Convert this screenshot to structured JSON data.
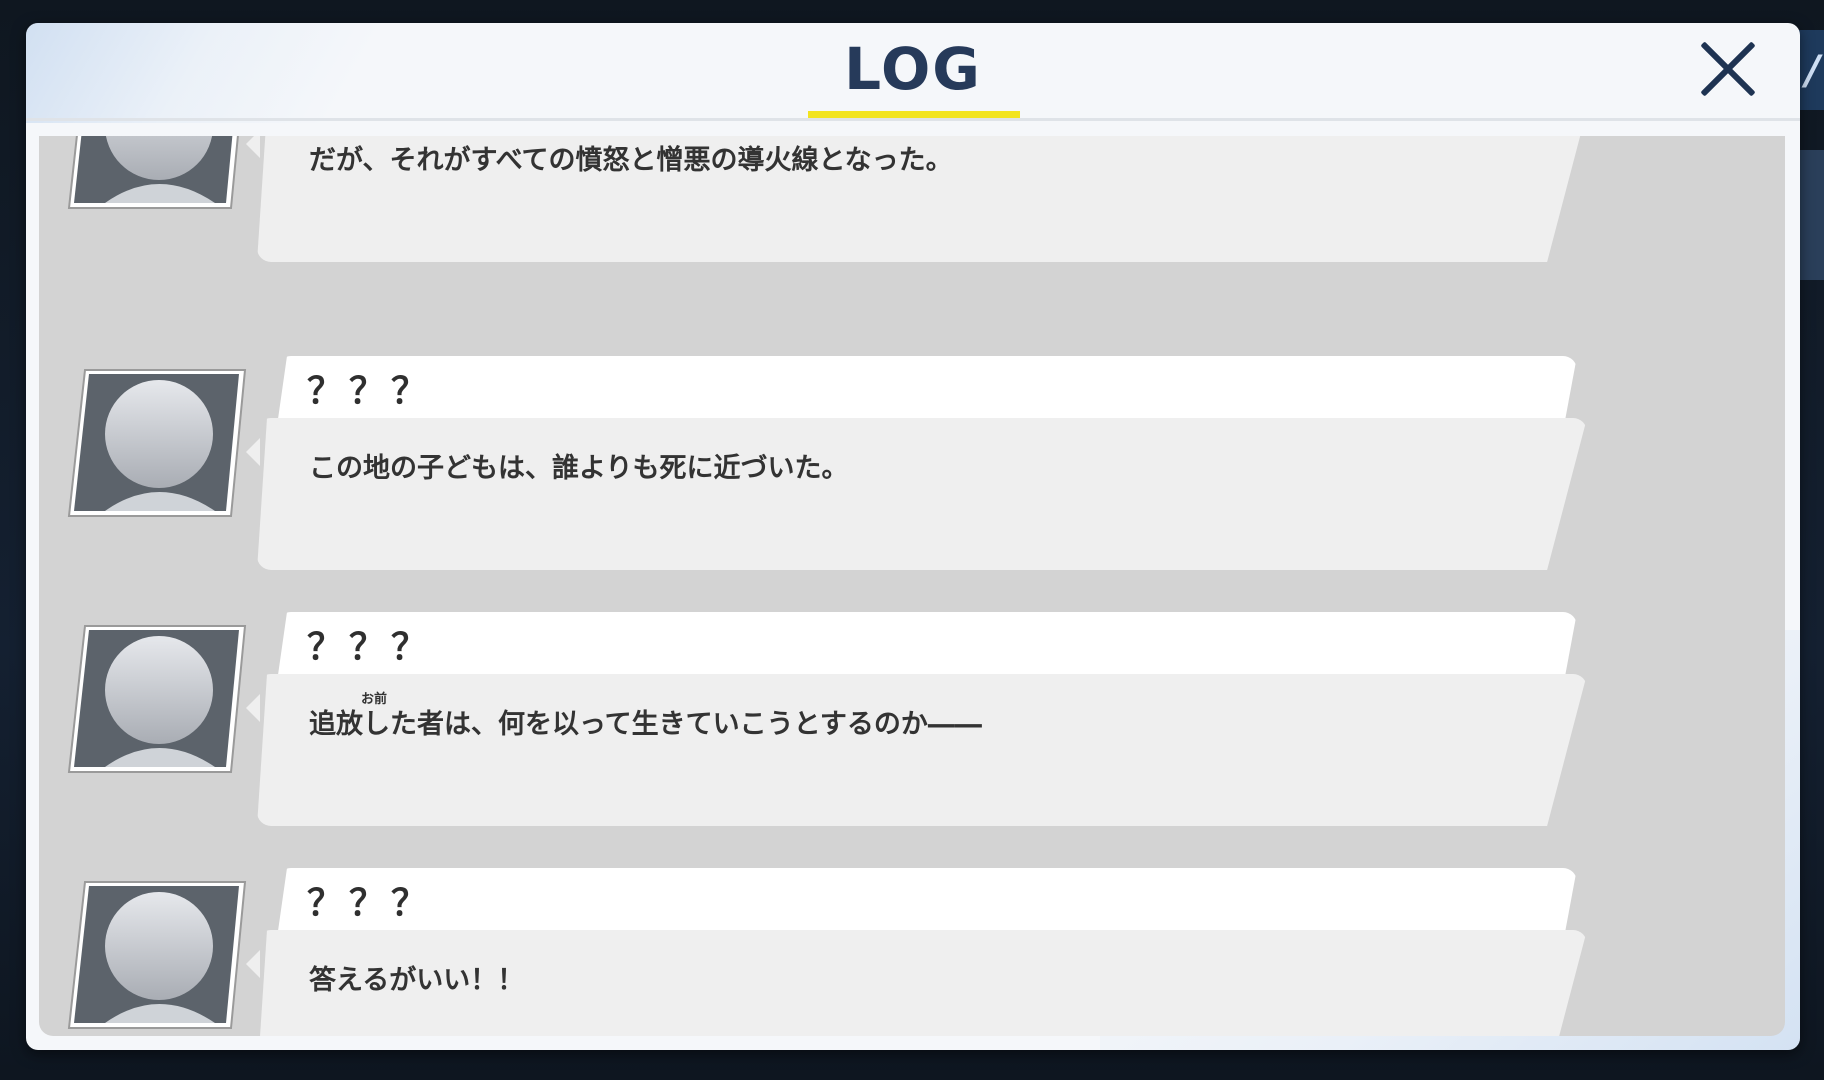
{
  "header": {
    "title": "LOG",
    "close_icon": "close-icon"
  },
  "colors": {
    "title": "#263a5a",
    "underline": "#f2e420",
    "log_background": "#d3d3d3",
    "bubble": "#efefef",
    "name_bar": "#ffffff"
  },
  "entries": [
    {
      "speaker": "",
      "avatar_icon": "unknown-speaker-silhouette",
      "text": "だが、それがすべての憤怒と憎悪の導火線となった。"
    },
    {
      "speaker": "？？？",
      "avatar_icon": "unknown-speaker-silhouette",
      "text": "この地の子どもは、誰よりも死に近づいた。"
    },
    {
      "speaker": "？？？",
      "avatar_icon": "unknown-speaker-silhouette",
      "text_before": "追放",
      "ruby_base": "し",
      "ruby": "お前",
      "text_after": "た者は、何を以って生きていこうとするのか――"
    },
    {
      "speaker": "？？？",
      "avatar_icon": "unknown-speaker-silhouette",
      "text": "答えるがいい！！"
    }
  ]
}
